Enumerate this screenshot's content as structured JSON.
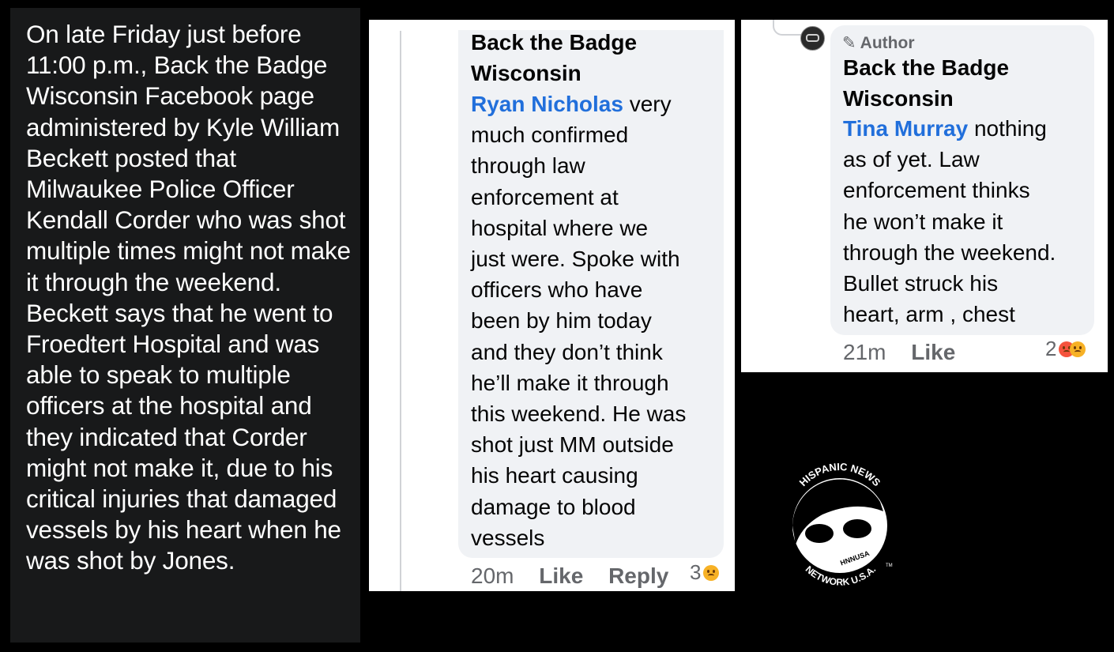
{
  "left_text": "On late Friday just before 11:00 p.m., Back the Badge Wisconsin Facebook page administered by Kyle William Beckett posted that Milwaukee Police Officer Kendall Corder who was shot multiple times might not make it through the weekend. Beckett says that he went to Froedtert Hospital and was able to speak to multiple officers at the hospital and they indicated that Corder might not make it, due to his critical injuries that damaged vessels by his heart when he was shot by Jones.",
  "comment1": {
    "author_line1": "Back the Badge",
    "author_line2": "Wisconsin",
    "mention": "Ryan Nicholas",
    "body_line1": " very",
    "body_lines": [
      "much confirmed",
      "through law",
      "enforcement at",
      "hospital where we",
      "just were. Spoke with",
      "officers who have",
      "been by him today",
      "and they don’t think",
      "he’ll make it through",
      "this weekend. He was",
      "shot just MM outside",
      "his heart causing",
      "damage to blood",
      "vessels"
    ],
    "time": "20m",
    "like": "Like",
    "reply": "Reply",
    "reaction_count": "3"
  },
  "comment2": {
    "badge": "Author",
    "author_line1": "Back the Badge",
    "author_line2": "Wisconsin",
    "mention": "Tina Murray",
    "body_line1": " nothing",
    "body_lines": [
      "as of yet. Law",
      "enforcement thinks",
      "he won’t make it",
      "through the weekend.",
      "Bullet struck his",
      "heart, arm , chest"
    ],
    "time": "21m",
    "like": "Like",
    "reaction_count": "2"
  },
  "logo": {
    "top_text": "HISPANIC NEWS",
    "bottom_text": "NETWORK U.S.A.",
    "center_text": "HNNUSA",
    "tm": "TM"
  },
  "colors": {
    "background": "#000000",
    "left_panel": "#18191a",
    "bubble": "#f0f2f5",
    "mention": "#216fdb",
    "meta": "#65676b"
  }
}
